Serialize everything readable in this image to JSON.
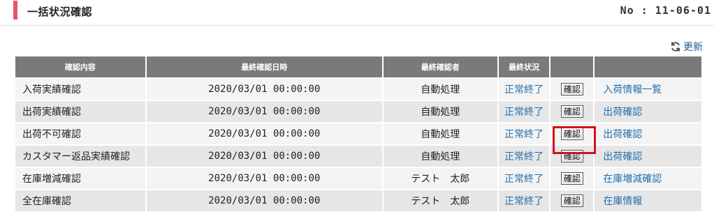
{
  "header": {
    "title": "一括状況確認",
    "doc_no": "No : 11-06-01"
  },
  "refresh_label": "更新",
  "table": {
    "columns": [
      "確認内容",
      "最終確認日時",
      "最終確認者",
      "最終状況",
      "",
      ""
    ],
    "rows": [
      {
        "item": "入荷実績確認",
        "datetime": "2020/03/01 00:00:00",
        "person": "自動処理",
        "status": "正常終了",
        "button": "確認",
        "link": "入荷情報一覧"
      },
      {
        "item": "出荷実績確認",
        "datetime": "2020/03/01 00:00:00",
        "person": "自動処理",
        "status": "正常終了",
        "button": "確認",
        "link": "出荷確認"
      },
      {
        "item": "出荷不可確認",
        "datetime": "2020/03/01 00:00:00",
        "person": "自動処理",
        "status": "正常終了",
        "button": "確認",
        "link": "出荷確認"
      },
      {
        "item": "カスタマー返品実績確認",
        "datetime": "2020/03/01 00:00:00",
        "person": "自動処理",
        "status": "正常終了",
        "button": "確認",
        "link": "出荷確認"
      },
      {
        "item": "在庫増減確認",
        "datetime": "2020/03/01 00:00:00",
        "person": "テスト　太郎",
        "status": "正常終了",
        "button": "確認",
        "link": "在庫増減確認"
      },
      {
        "item": "全在庫確認",
        "datetime": "2020/03/01 00:00:00",
        "person": "テスト　太郎",
        "status": "正常終了",
        "button": "確認",
        "link": "在庫情報"
      }
    ]
  },
  "colors": {
    "accent": "#e8546c",
    "header_bg": "#7a7a7a",
    "link": "#1f6fb0",
    "highlight": "#d0121b"
  }
}
